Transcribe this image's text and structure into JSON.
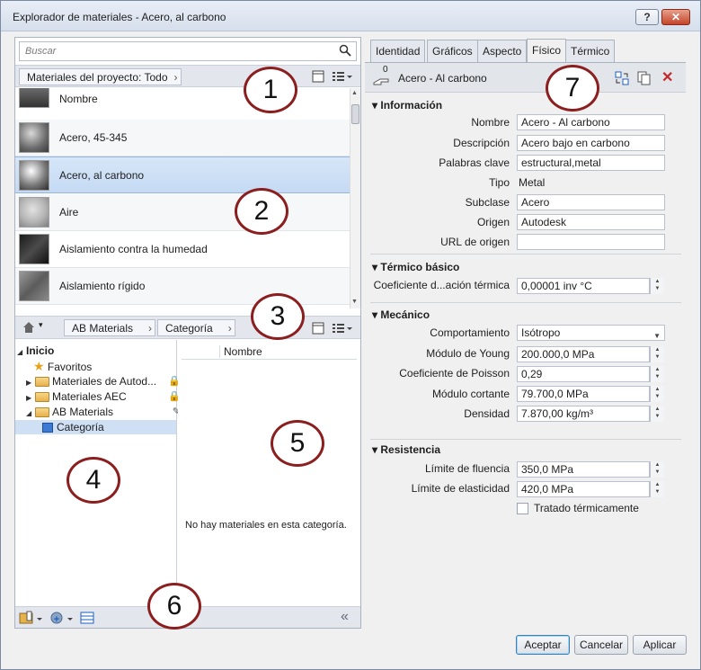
{
  "window": {
    "title": "Explorador de materiales - Acero, al carbono",
    "help_label": "?",
    "close_label": "✕"
  },
  "search": {
    "placeholder": "Buscar"
  },
  "library_bar": {
    "crumb": "Materiales del proyecto: Todo"
  },
  "materials": {
    "header": "Nombre",
    "items": [
      "Acero, 45-345",
      "Acero, al carbono",
      "Aire",
      "Aislamiento contra la humedad",
      "Aislamiento rígido"
    ],
    "selected": "Acero, al carbono"
  },
  "nav_bar": {
    "crumb1": "AB Materials",
    "crumb2": "Categoría"
  },
  "tree": {
    "root": "Inicio",
    "items": [
      "Favoritos",
      "Materiales de Autod...",
      "Materiales AEC",
      "AB Materials",
      "Categoría"
    ]
  },
  "detail": {
    "column": "Nombre",
    "empty": "No hay materiales en esta categoría."
  },
  "tabs": [
    "Identidad",
    "Gráficos",
    "Aspecto",
    "Físico",
    "Térmico"
  ],
  "active_tab": "Físico",
  "asset": {
    "count": "0",
    "name": "Acero - Al carbono"
  },
  "sections": {
    "informacion": {
      "title": "Información",
      "labels": [
        "Nombre",
        "Descripción",
        "Palabras clave",
        "Tipo",
        "Subclase",
        "Origen",
        "URL de origen"
      ],
      "values": [
        "Acero - Al carbono",
        "Acero bajo en carbono",
        "estructural,metal",
        "Metal",
        "Acero",
        "Autodesk",
        ""
      ]
    },
    "termico": {
      "title": "Térmico básico",
      "label": "Coeficiente d...ación térmica",
      "value": "0,00001 inv °C"
    },
    "mecanico": {
      "title": "Mecánico",
      "labels": [
        "Comportamiento",
        "Módulo de Young",
        "Coeficiente de Poisson",
        "Módulo cortante",
        "Densidad"
      ],
      "values": [
        "Isótropo",
        "200.000,0 MPa",
        "0,29",
        "79.700,0 MPa",
        "7.870,00 kg/m³"
      ]
    },
    "resistencia": {
      "title": "Resistencia",
      "labels": [
        "Límite de fluencia",
        "Límite de elasticidad"
      ],
      "values": [
        "350,0 MPa",
        "420,0 MPa"
      ],
      "checkbox": "Tratado térmicamente"
    }
  },
  "buttons": {
    "ok": "Aceptar",
    "cancel": "Cancelar",
    "apply": "Aplicar"
  },
  "callouts": [
    "1",
    "2",
    "3",
    "4",
    "5",
    "6",
    "7"
  ]
}
